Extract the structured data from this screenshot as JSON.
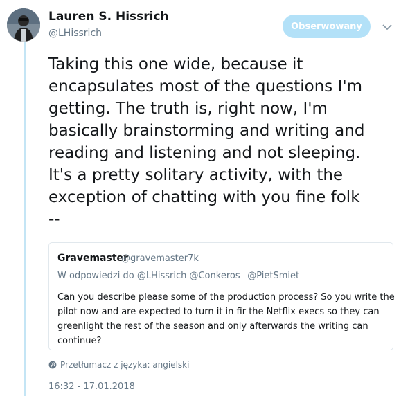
{
  "author": {
    "display_name": "Lauren S. Hissrich",
    "handle": "@LHissrich",
    "avatar_icon": "profile-photo"
  },
  "follow_button": {
    "label": "Obserwowany",
    "color": "#b3e1f8"
  },
  "menu": {
    "icon": "chevron-down-icon"
  },
  "tweet": {
    "lines": [
      "Taking this one wide, because it",
      "encapsulates most of the questions I'm",
      "getting. The truth is, right now, I'm",
      "basically brainstorming and writing and",
      "reading and listening and not sleeping.",
      "It's a pretty solitary activity, with the",
      "exception of chatting with you fine folk",
      "--"
    ]
  },
  "quote": {
    "display_name": "Gravemaster",
    "handle": "@gravemaster7k",
    "reply_prefix": "W odpowiedzi do",
    "reply_mentions": [
      "@LHissrich",
      "@Conkeros_",
      "@PietSmiet"
    ],
    "lines": [
      "Can you describe please some of the production process? So you write the",
      "pilot now and are expected to turn it in fir the Netflix execs so they can",
      "greenlight the rest of the season and only afterwards the writing can",
      "continue?"
    ]
  },
  "translate": {
    "icon": "globe-icon",
    "label": "Przetłumacz z języka: angielski"
  },
  "timestamp": "16:32 - 17.01.2018",
  "colors": {
    "thread_line": "#c4e5f5",
    "secondary_text": "#657786",
    "border": "#e1e8ed"
  }
}
